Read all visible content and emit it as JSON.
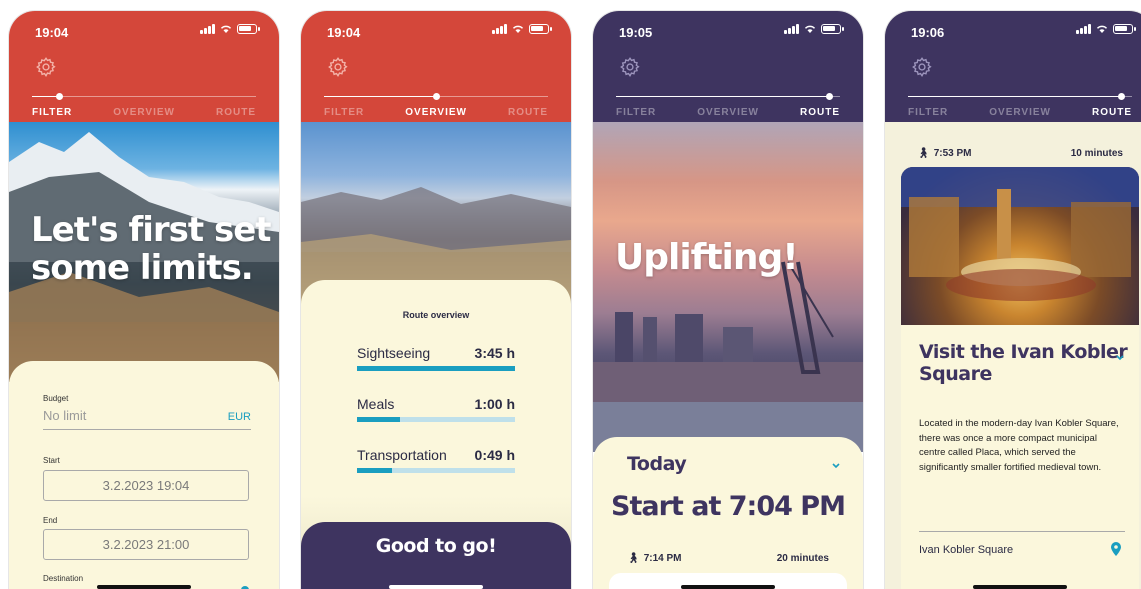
{
  "colors": {
    "red_header": "#d4473a",
    "purple_header": "#3e3460",
    "card": "#fbf7dc",
    "accent_blue": "#1a9ec0"
  },
  "tabs": [
    "FILTER",
    "OVERVIEW",
    "ROUTE"
  ],
  "screens": [
    {
      "time": "19:04",
      "active_tab": 0,
      "progress": 0.12,
      "headline": [
        "Let's first set",
        "some limits."
      ],
      "budget_label": "Budget",
      "budget_placeholder": "No limit",
      "currency": "EUR",
      "start_label": "Start",
      "start_value": "3.2.2023 19:04",
      "end_label": "End",
      "end_value": "3.2.2023 21:00",
      "destination_label": "Destination"
    },
    {
      "time": "19:04",
      "active_tab": 1,
      "progress": 0.5,
      "overview_title": "Route overview",
      "items": [
        {
          "label": "Sightseeing",
          "value": "3:45 h",
          "fraction": 1.0
        },
        {
          "label": "Meals",
          "value": "1:00 h",
          "fraction": 0.27
        },
        {
          "label": "Transportation",
          "value": "0:49 h",
          "fraction": 0.22
        }
      ],
      "cta": "Good to go!"
    },
    {
      "time": "19:05",
      "active_tab": 2,
      "progress": 0.95,
      "headline": "Uplifting!",
      "day": "Today",
      "start_text": "Start at 7:04 PM",
      "walk_time": "7:14 PM",
      "duration": "20 minutes"
    },
    {
      "time": "19:06",
      "active_tab": 2,
      "progress": 0.95,
      "walk_time": "7:53 PM",
      "duration": "10 minutes",
      "place_title": [
        "Visit the Ivan Kobler",
        "Square"
      ],
      "description": "Located in the modern-day Ivan Kobler Square, there was once a more compact municipal centre called Placa, which served the significantly smaller fortified medieval town.",
      "location": "Ivan Kobler Square"
    }
  ]
}
